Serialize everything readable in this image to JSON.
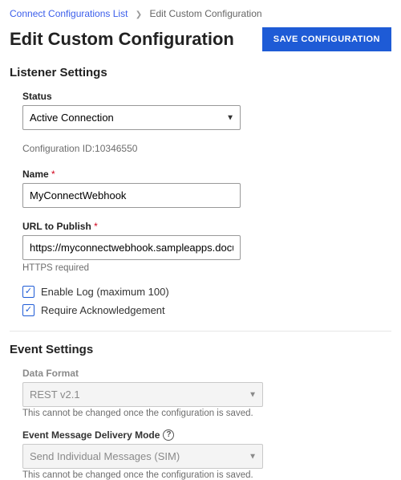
{
  "breadcrumb": {
    "back_label": "Connect Configurations List",
    "current": "Edit Custom Configuration"
  },
  "header": {
    "title": "Edit Custom Configuration",
    "save_label": "SAVE CONFIGURATION"
  },
  "listener": {
    "section_title": "Listener Settings",
    "status_label": "Status",
    "status_value": "Active Connection",
    "config_id_label": "Configuration ID:",
    "config_id_value": "10346550",
    "name_label": "Name",
    "name_value": "MyConnectWebhook",
    "url_label": "URL to Publish",
    "url_value": "https://myconnectwebhook.sampleapps.docusign.com/a",
    "url_helper": "HTTPS required",
    "enable_log_label": "Enable Log (maximum 100)",
    "require_ack_label": "Require Acknowledgement"
  },
  "event": {
    "section_title": "Event Settings",
    "data_format_label": "Data Format",
    "data_format_value": "REST v2.1",
    "locked_helper": "This cannot be changed once the configuration is saved.",
    "delivery_label": "Event Message Delivery Mode",
    "delivery_value": "Send Individual Messages (SIM)"
  }
}
